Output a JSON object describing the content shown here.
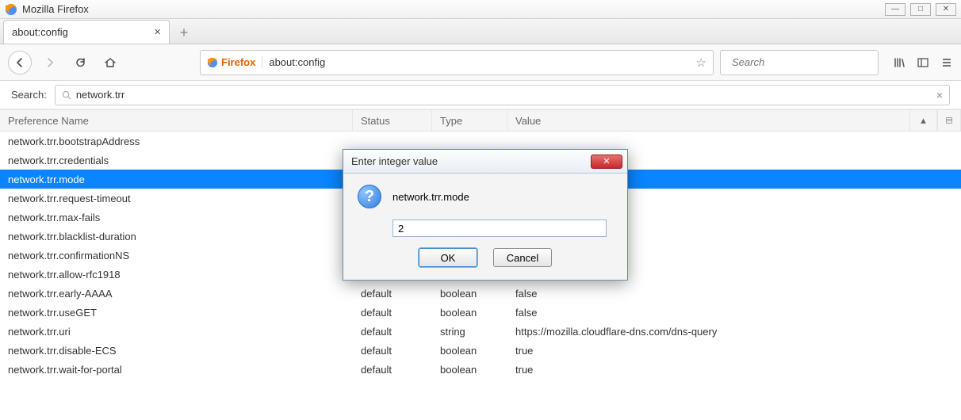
{
  "window": {
    "title": "Mozilla Firefox"
  },
  "tab": {
    "title": "about:config"
  },
  "urlbar": {
    "brand": "Firefox",
    "url": "about:config"
  },
  "searchbar": {
    "placeholder": "Search"
  },
  "config_search": {
    "label": "Search:",
    "value": "network.trr"
  },
  "columns": {
    "name": "Preference Name",
    "status": "Status",
    "type": "Type",
    "value": "Value"
  },
  "rows": [
    {
      "name": "network.trr.bootstrapAddress",
      "status": "",
      "type": "",
      "value": "",
      "selected": false
    },
    {
      "name": "network.trr.credentials",
      "status": "",
      "type": "",
      "value": "",
      "selected": false
    },
    {
      "name": "network.trr.mode",
      "status": "",
      "type": "",
      "value": "",
      "selected": true
    },
    {
      "name": "network.trr.request-timeout",
      "status": "",
      "type": "",
      "value": "",
      "selected": false
    },
    {
      "name": "network.trr.max-fails",
      "status": "",
      "type": "",
      "value": "",
      "selected": false
    },
    {
      "name": "network.trr.blacklist-duration",
      "status": "",
      "type": "",
      "value": "",
      "selected": false
    },
    {
      "name": "network.trr.confirmationNS",
      "status": "",
      "type": "",
      "value": "",
      "selected": false
    },
    {
      "name": "network.trr.allow-rfc1918",
      "status": "default",
      "type": "boolean",
      "value": "false",
      "selected": false
    },
    {
      "name": "network.trr.early-AAAA",
      "status": "default",
      "type": "boolean",
      "value": "false",
      "selected": false
    },
    {
      "name": "network.trr.useGET",
      "status": "default",
      "type": "boolean",
      "value": "false",
      "selected": false
    },
    {
      "name": "network.trr.uri",
      "status": "default",
      "type": "string",
      "value": "https://mozilla.cloudflare-dns.com/dns-query",
      "selected": false
    },
    {
      "name": "network.trr.disable-ECS",
      "status": "default",
      "type": "boolean",
      "value": "true",
      "selected": false
    },
    {
      "name": "network.trr.wait-for-portal",
      "status": "default",
      "type": "boolean",
      "value": "true",
      "selected": false
    }
  ],
  "dialog": {
    "title": "Enter integer value",
    "pref": "network.trr.mode",
    "value": "2",
    "ok": "OK",
    "cancel": "Cancel"
  }
}
